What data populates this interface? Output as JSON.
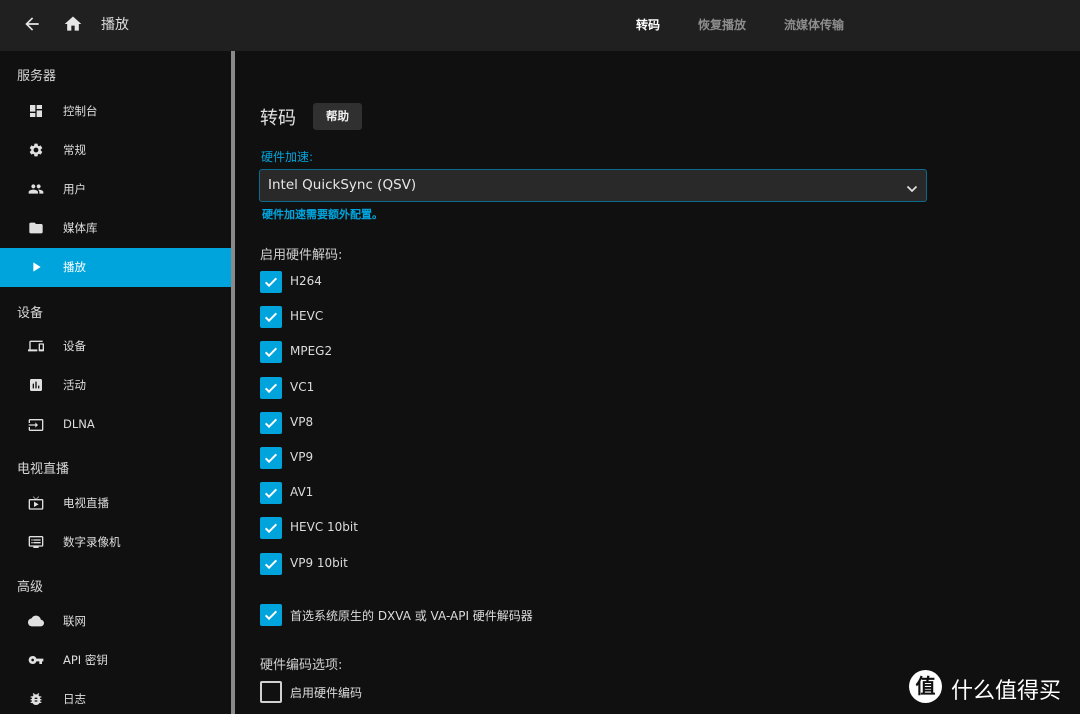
{
  "header": {
    "title": "播放",
    "back_icon": "arrow-left",
    "home_icon": "home",
    "tabs": [
      {
        "label": "转码",
        "active": true
      },
      {
        "label": "恢复播放",
        "active": false
      },
      {
        "label": "流媒体传输",
        "active": false
      }
    ]
  },
  "sidebar": {
    "sections": [
      {
        "title": "服务器",
        "items": [
          {
            "label": "控制台",
            "icon": "dashboard",
            "active": false
          },
          {
            "label": "常规",
            "icon": "gear",
            "active": false
          },
          {
            "label": "用户",
            "icon": "people",
            "active": false
          },
          {
            "label": "媒体库",
            "icon": "folder",
            "active": false
          },
          {
            "label": "播放",
            "icon": "play",
            "active": true
          }
        ]
      },
      {
        "title": "设备",
        "items": [
          {
            "label": "设备",
            "icon": "devices",
            "active": false
          },
          {
            "label": "活动",
            "icon": "assessment",
            "active": false
          },
          {
            "label": "DLNA",
            "icon": "input",
            "active": false
          }
        ]
      },
      {
        "title": "电视直播",
        "items": [
          {
            "label": "电视直播",
            "icon": "live-tv",
            "active": false
          },
          {
            "label": "数字录像机",
            "icon": "dvr",
            "active": false
          }
        ]
      },
      {
        "title": "高级",
        "items": [
          {
            "label": "联网",
            "icon": "cloud",
            "active": false
          },
          {
            "label": "API 密钥",
            "icon": "vpn-key",
            "active": false
          },
          {
            "label": "日志",
            "icon": "bug",
            "active": false
          }
        ]
      }
    ]
  },
  "main": {
    "title": "转码",
    "help_label": "帮助",
    "hw_accel": {
      "label": "硬件加速:",
      "value": "Intel QuickSync (QSV)",
      "hint": "硬件加速需要额外配置。"
    },
    "hw_decode": {
      "label": "启用硬件解码:",
      "codecs": [
        {
          "label": "H264",
          "checked": true
        },
        {
          "label": "HEVC",
          "checked": true
        },
        {
          "label": "MPEG2",
          "checked": true
        },
        {
          "label": "VC1",
          "checked": true
        },
        {
          "label": "VP8",
          "checked": true
        },
        {
          "label": "VP9",
          "checked": true
        },
        {
          "label": "AV1",
          "checked": true
        },
        {
          "label": "HEVC 10bit",
          "checked": true
        },
        {
          "label": "VP9 10bit",
          "checked": true
        }
      ]
    },
    "prefer_native": {
      "label": "首选系统原生的 DXVA 或 VA-API 硬件解码器",
      "checked": true
    },
    "hw_encode": {
      "label": "硬件编码选项:",
      "enable": {
        "label": "启用硬件编码",
        "checked": false
      }
    }
  },
  "watermark": {
    "logo_char": "值",
    "text": "什么值得买"
  },
  "colors": {
    "accent": "#00a4dc",
    "header_bg": "#202020",
    "page_bg": "#101010",
    "select_bg": "#292929"
  }
}
